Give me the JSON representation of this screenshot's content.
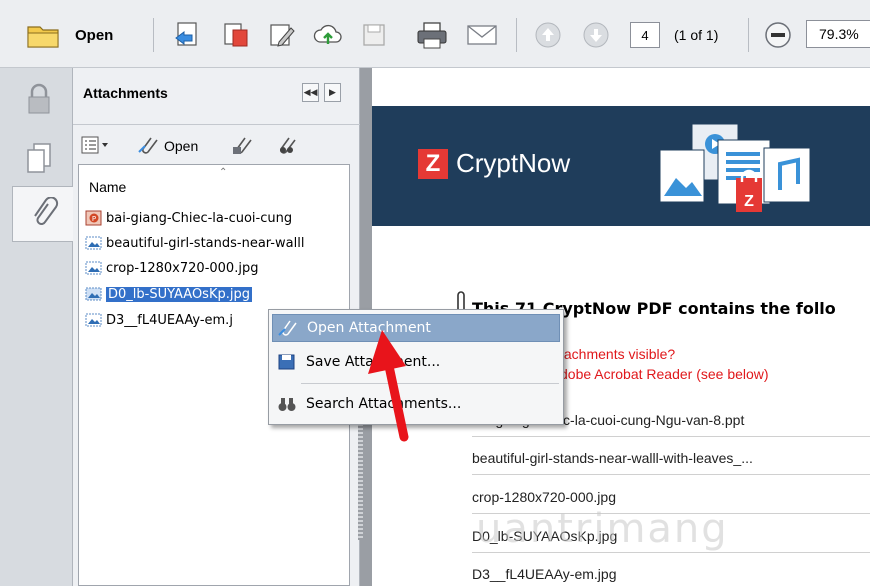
{
  "toolbar": {
    "open_label": "Open",
    "page_number": "4",
    "page_count": "(1 of 1)",
    "zoom": "79.3%"
  },
  "panel": {
    "title": "Attachments",
    "open_label": "Open",
    "column_header": "Name",
    "files": [
      {
        "name": "bai-giang-Chiec-la-cuoi-cung",
        "icon": "ppt-file-icon"
      },
      {
        "name": "beautiful-girl-stands-near-walll",
        "icon": "image-file-icon"
      },
      {
        "name": "crop-1280x720-000.jpg",
        "icon": "image-file-icon"
      },
      {
        "name": "D0_lb-SUYAAOsKp.jpg",
        "icon": "image-file-icon"
      },
      {
        "name": "D3__fL4UEAAy-em.j",
        "icon": "image-file-icon"
      }
    ]
  },
  "document": {
    "brand": "CryptNow",
    "heading": "This 71 CryptNow PDF contains the follo",
    "notice_line1": "tachments visible?",
    "notice_line2": "dobe Acrobat Reader (see below)",
    "attachments": [
      "bai-giang-Chiec-la-cuoi-cung-Ngu-van-8.ppt",
      "beautiful-girl-stands-near-walll-with-leaves_...",
      "crop-1280x720-000.jpg",
      "D0_lb-SUYAAOsKp.jpg",
      "D3__fL4UEAAy-em.jpg"
    ],
    "watermark": "uantrimang"
  },
  "context_menu": {
    "items": [
      {
        "label": "Open Attachment",
        "icon": "open-attachment-icon"
      },
      {
        "label": "Save Attachment...",
        "icon": "save-icon"
      },
      {
        "label": "Search Attachments...",
        "icon": "binoculars-icon"
      }
    ]
  },
  "colors": {
    "selection": "#3370c9",
    "menu_highlight": "#8aa7c9",
    "banner": "#1f3d5b",
    "notice_red": "#e0181b",
    "arrow_red": "#e8141b"
  }
}
